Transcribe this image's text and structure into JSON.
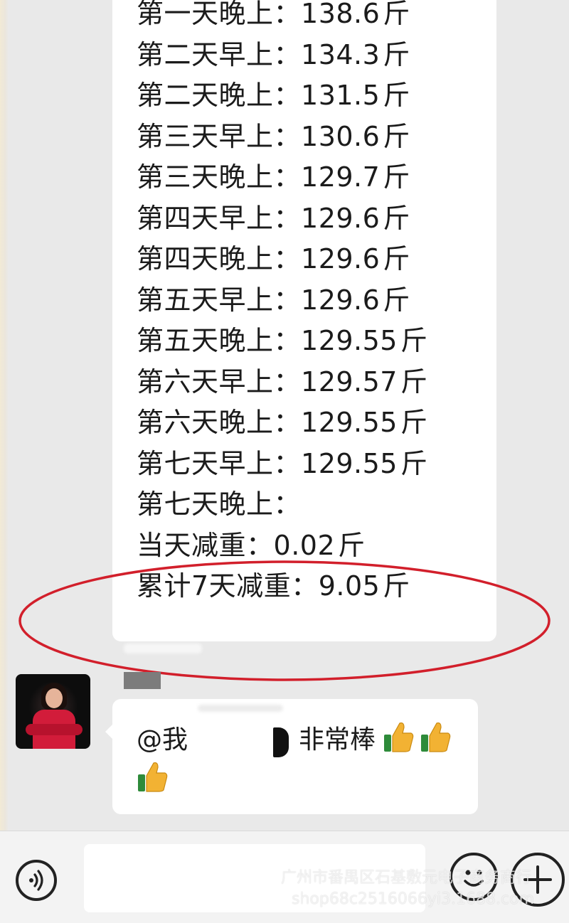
{
  "weight_log": [
    {
      "label": "第一天晚上：",
      "value": "138.6",
      "unit": "斤"
    },
    {
      "label": "第二天早上：",
      "value": "134.3",
      "unit": "斤"
    },
    {
      "label": "第二天晚上：",
      "value": "131.5",
      "unit": "斤"
    },
    {
      "label": "第三天早上：",
      "value": "130.6",
      "unit": "斤"
    },
    {
      "label": "第三天晚上：",
      "value": "129.7",
      "unit": "斤"
    },
    {
      "label": "第四天早上：",
      "value": "129.6",
      "unit": "斤"
    },
    {
      "label": "第四天晚上：",
      "value": "129.6",
      "unit": "斤"
    },
    {
      "label": "第五天早上：",
      "value": "129.6",
      "unit": "斤"
    },
    {
      "label": "第五天晚上：",
      "value": "129.55",
      "unit": "斤"
    },
    {
      "label": "第六天早上：",
      "value": "129.57",
      "unit": "斤"
    },
    {
      "label": "第六天晚上：",
      "value": "129.55",
      "unit": "斤"
    },
    {
      "label": "第七天早上：",
      "value": "129.55",
      "unit": "斤"
    },
    {
      "label": "第七天晚上：",
      "value": "",
      "unit": ""
    },
    {
      "label": "当天减重：",
      "value": "0.02",
      "unit": "斤"
    },
    {
      "label": "累计7天减重：",
      "value": "9.05",
      "unit": "斤"
    }
  ],
  "reply": {
    "mention": "@我",
    "text": "非常棒"
  },
  "colors": {
    "annotation_circle": "#d21f2b",
    "chat_background": "#e9e9e9",
    "bubble": "#ffffff"
  },
  "icons": {
    "voice": "voice-icon",
    "emoji": "emoji-icon",
    "plus": "plus-icon",
    "thumb": "thumbs-up-emoji"
  },
  "watermark": {
    "line1": "广州市番禺区石基敷元电子商务商行",
    "line2": "shop68c2516066yi3.1688.com"
  }
}
